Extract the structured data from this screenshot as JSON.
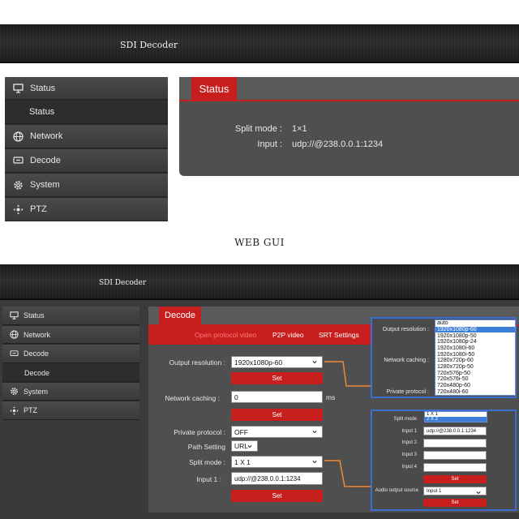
{
  "top": {
    "brand": "SDI Decoder",
    "sidebar": {
      "items": [
        {
          "label": "Status",
          "icon": "monitor-icon"
        },
        {
          "label": "Status",
          "sub": true
        },
        {
          "label": "Network",
          "icon": "globe-icon"
        },
        {
          "label": "Decode",
          "icon": "decoder-icon"
        },
        {
          "label": "System",
          "icon": "gear-icon"
        },
        {
          "label": "PTZ",
          "icon": "ptz-icon"
        }
      ]
    },
    "panel": {
      "tab": "Status",
      "split_mode_label": "Split mode :",
      "split_mode_value": "1×1",
      "input_label": "Input :",
      "input_value": "udp://@238.0.0.1:1234"
    }
  },
  "caption": "WEB GUI",
  "bottom": {
    "brand": "SDI Decoder",
    "sidebar": {
      "items": [
        {
          "label": "Status",
          "icon": "monitor-icon"
        },
        {
          "label": "Network",
          "icon": "globe-icon"
        },
        {
          "label": "Decode",
          "icon": "decoder-icon"
        },
        {
          "label": "Decode",
          "sub": true
        },
        {
          "label": "System",
          "icon": "gear-icon"
        },
        {
          "label": "PTZ",
          "icon": "ptz-icon"
        }
      ]
    },
    "panel": {
      "tab": "Decode",
      "subtabs": [
        "Open protocol video",
        "P2P video",
        "SRT Settings"
      ],
      "output_resolution_label": "Output resolution :",
      "output_resolution_value": "1920x1080p-60",
      "set": "Set",
      "network_caching_label": "Network caching :",
      "network_caching_value": "0",
      "network_caching_unit": "ms",
      "private_protocol_label": "Private protocol :",
      "private_protocol_value": "OFF",
      "path_setting_label": "Path Setting",
      "path_setting_value": "URL",
      "split_mode_label": "Split mode :",
      "split_mode_value": "1 X 1",
      "input1_label": "Input 1 :",
      "input1_value": "udp://@238.0.0.1:1234"
    },
    "inset1": {
      "output_resolution_label": "Output resolution :",
      "network_caching_label": "Network caching :",
      "private_protocol_label": "Private protocol :",
      "options": [
        "auto",
        "1920x1080p-60",
        "1920x1080p-50",
        "1920x1080p-24",
        "1920x1080i-60",
        "1920x1080i-50",
        "1280x720p-60",
        "1280x720p-50",
        "720x576p-50",
        "720x576i-50",
        "720x480p-60",
        "720x480i-60"
      ],
      "selected": "1920x1080p-60"
    },
    "inset2": {
      "options": [
        "1 X 1",
        "2 X 2"
      ],
      "split_mode_label": "Split mode",
      "input1_label": "Input 1",
      "input1_value": "udp://@238.0.0.1:1234",
      "input2_label": "Input 2",
      "input3_label": "Input 3",
      "input4_label": "Input 4",
      "set": "Set",
      "audio_label": "Audio output source",
      "audio_value": "Input 1"
    }
  }
}
